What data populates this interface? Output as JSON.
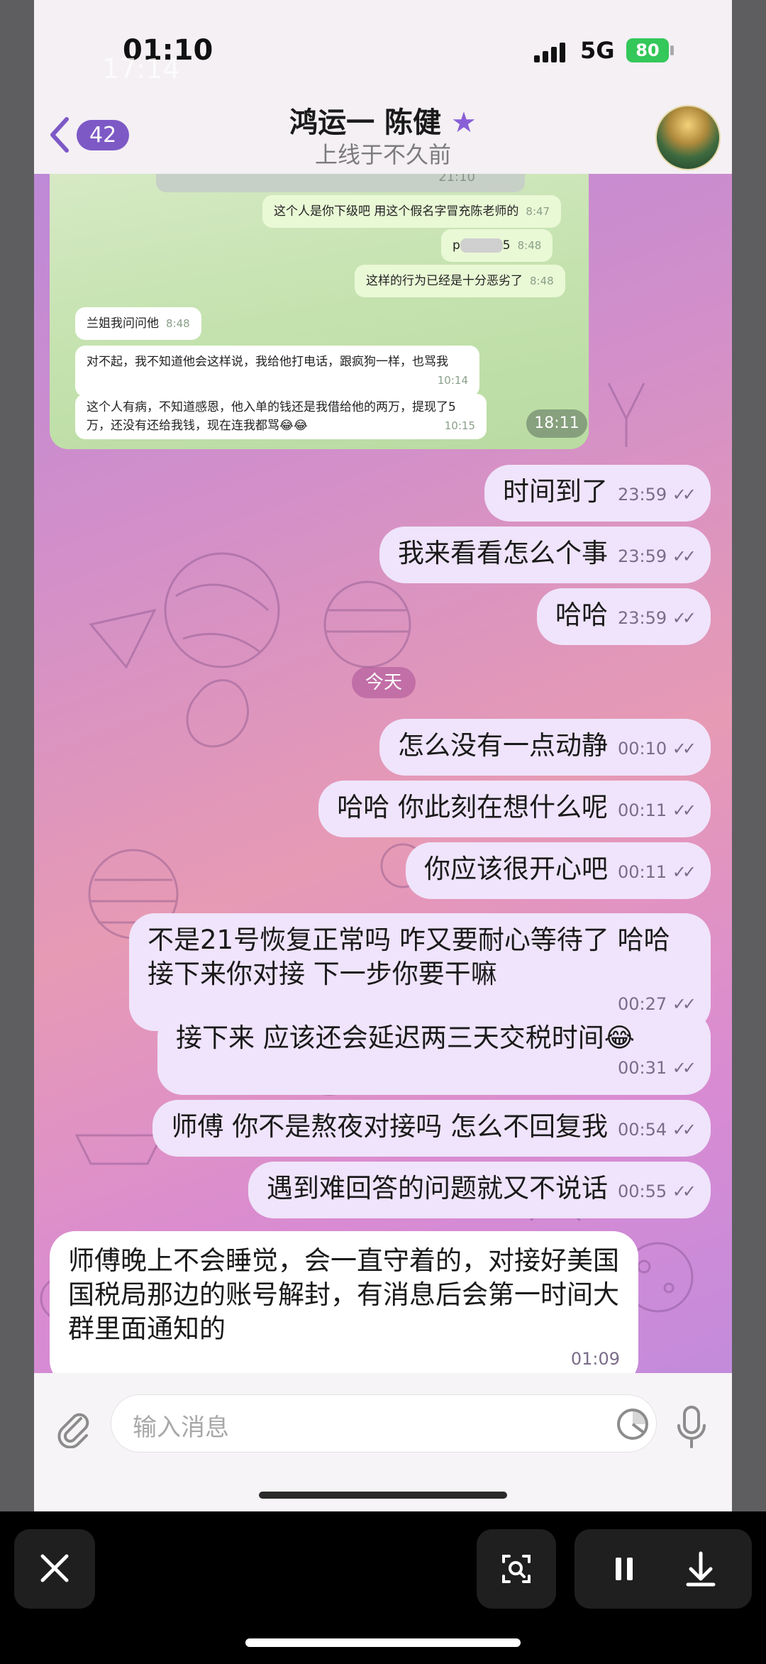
{
  "status_bar": {
    "time": "01:10",
    "ghost_time": "17:14",
    "network": "5G",
    "battery": "80"
  },
  "header": {
    "back_count": "42",
    "title": "鸿运一 陈健",
    "title_star": "★",
    "subtitle": "上线于不久前"
  },
  "embedded_screenshot": {
    "top_time": "21:10",
    "bubbles": [
      {
        "text": "这个人是你下级吧 用这个假名字冒充陈老师的",
        "time": "8:47",
        "side": "out"
      },
      {
        "text": "p",
        "text_tail": "5",
        "time": "8:48",
        "side": "out"
      },
      {
        "text": "这样的行为已经是十分恶劣了",
        "time": "8:48",
        "side": "out"
      },
      {
        "text": "兰姐我问问他",
        "time": "8:48",
        "side": "in"
      },
      {
        "text": "对不起，我不知道他会这样说，我给他打电话，跟疯狗一样，也骂我",
        "time": "10:14",
        "side": "in"
      },
      {
        "text": "这个人有病，不知道感恩，他入单的钱还是我借给他的两万，提现了5万，还没有还给我钱，现在连我都骂😂😂",
        "time": "10:15",
        "side": "in"
      }
    ],
    "time_badge": "18:11"
  },
  "messages": [
    {
      "text": "时间到了",
      "time": "23:59",
      "side": "out"
    },
    {
      "text": "我来看看怎么个事",
      "time": "23:59",
      "side": "out"
    },
    {
      "text": "哈哈",
      "time": "23:59",
      "side": "out"
    },
    {
      "text": "怎么没有一点动静",
      "time": "00:10",
      "side": "out"
    },
    {
      "text": "哈哈 你此刻在想什么呢",
      "time": "00:11",
      "side": "out"
    },
    {
      "text": "你应该很开心吧",
      "time": "00:11",
      "side": "out"
    },
    {
      "text": "不是21号恢复正常吗 咋又要耐心等待了 哈哈 接下来你对接  下一步你要干嘛",
      "time": "00:27",
      "side": "out"
    },
    {
      "text": "接下来 应该还会延迟两三天交税时间😂",
      "time": "00:31",
      "side": "out"
    },
    {
      "text": "师傅 你不是熬夜对接吗 怎么不回复我",
      "time": "00:54",
      "side": "out"
    },
    {
      "text": "遇到难回答的问题就又不说话",
      "time": "00:55",
      "side": "out"
    },
    {
      "text": "师傅晚上不会睡觉，会一直守着的，对接好美国国税局那边的账号解封，有消息后会第一时间大群里面通知的",
      "time": "01:09",
      "side": "in"
    }
  ],
  "day_separator": "今天",
  "input": {
    "placeholder": "输入消息"
  },
  "colors": {
    "accent": "#7d59c6",
    "outgoing_bubble": "#efe4fb",
    "incoming_bubble": "#ffffff"
  }
}
